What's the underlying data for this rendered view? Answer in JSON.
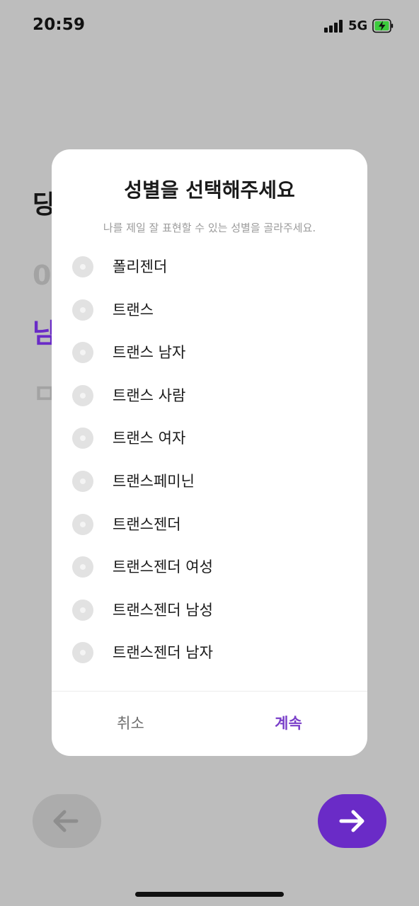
{
  "status_bar": {
    "time": "20:59",
    "network": "5G"
  },
  "background": {
    "heading_fragment": "당",
    "number_fragment": "0",
    "selected_fragment": "남",
    "box_fragment": "ㅁ",
    "accent_color": "#6a2bc7"
  },
  "modal": {
    "title": "성별을 선택해주세요",
    "subtitle": "나를 제일 잘 표현할 수 있는 성별을 골라주세요.",
    "options": [
      {
        "label": "폴리젠더",
        "selected": false
      },
      {
        "label": "트랜스",
        "selected": false
      },
      {
        "label": "트랜스 남자",
        "selected": false
      },
      {
        "label": "트랜스 사람",
        "selected": false
      },
      {
        "label": "트랜스 여자",
        "selected": false
      },
      {
        "label": "트랜스페미닌",
        "selected": false
      },
      {
        "label": "트랜스젠더",
        "selected": false
      },
      {
        "label": "트랜스젠더 여성",
        "selected": false
      },
      {
        "label": "트랜스젠더 남성",
        "selected": false
      },
      {
        "label": "트랜스젠더 남자",
        "selected": false
      }
    ],
    "cancel_label": "취소",
    "continue_label": "계속"
  },
  "nav": {
    "back_icon": "arrow-left-icon",
    "next_icon": "arrow-right-icon"
  }
}
